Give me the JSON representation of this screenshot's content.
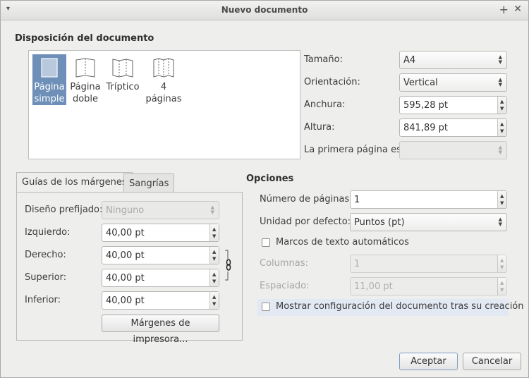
{
  "window": {
    "title": "Nuevo documento",
    "menu_icon": "▾",
    "plus_icon": "+",
    "close_icon": "✕"
  },
  "layout": {
    "heading": "Disposición del documento",
    "items": [
      {
        "line1": "Página",
        "line2": "simple",
        "selected": true
      },
      {
        "line1": "Página",
        "line2": "doble",
        "selected": false
      },
      {
        "line1": "Tríptico",
        "line2": "",
        "selected": false
      },
      {
        "line1": "4",
        "line2": "páginas",
        "selected": false
      }
    ]
  },
  "page": {
    "size_label": "Tamaño:",
    "size_value": "A4",
    "orientation_label": "Orientación:",
    "orientation_value": "Vertical",
    "width_label": "Anchura:",
    "width_value": "595,28 pt",
    "height_label": "Altura:",
    "height_value": "841,89 pt",
    "first_page_label": "La primera página es:",
    "first_page_value": ""
  },
  "margins": {
    "tab_guides": "Guías de los márgenes",
    "tab_bleeds": "Sangrías",
    "preset_label": "Diseño prefijado:",
    "preset_value": "Ninguno",
    "left_label": "Izquierdo:",
    "left_value": "40,00 pt",
    "right_label": "Derecho:",
    "right_value": "40,00 pt",
    "top_label": "Superior:",
    "top_value": "40,00 pt",
    "bottom_label": "Inferior:",
    "bottom_value": "40,00 pt",
    "printer_button": "Márgenes de impresora..."
  },
  "options": {
    "heading": "Opciones",
    "pages_label": "Número de páginas:",
    "pages_value": "1",
    "unit_label": "Unidad por defecto:",
    "unit_value": "Puntos (pt)",
    "auto_frames_label": "Marcos de texto automáticos",
    "columns_label": "Columnas:",
    "columns_value": "1",
    "gap_label": "Espaciado:",
    "gap_value": "11,00 pt",
    "show_settings_label": "Mostrar configuración del documento tras su creación"
  },
  "buttons": {
    "ok": "Aceptar",
    "cancel": "Cancelar"
  }
}
